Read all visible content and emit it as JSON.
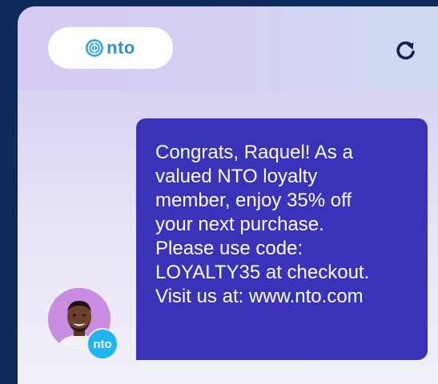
{
  "header": {
    "logo_text": "nto",
    "logo_icon": "nto-globe-icon",
    "refresh_icon": "refresh-icon"
  },
  "message": {
    "text": "Congrats, Raquel! As a\nvalued NTO loyalty\nmember, enjoy 35% off\nyour next purchase.\nPlease use code:\nLOYALTY35 at checkout.\nVisit us at: www.nto.com"
  },
  "sender": {
    "avatar_icon": "person-avatar",
    "badge_text": "nto"
  },
  "colors": {
    "bubble": "#3a32b8",
    "badge": "#1fb4ee",
    "logo": "#2f8fd0",
    "avatar_bg": "#c88ce0"
  }
}
